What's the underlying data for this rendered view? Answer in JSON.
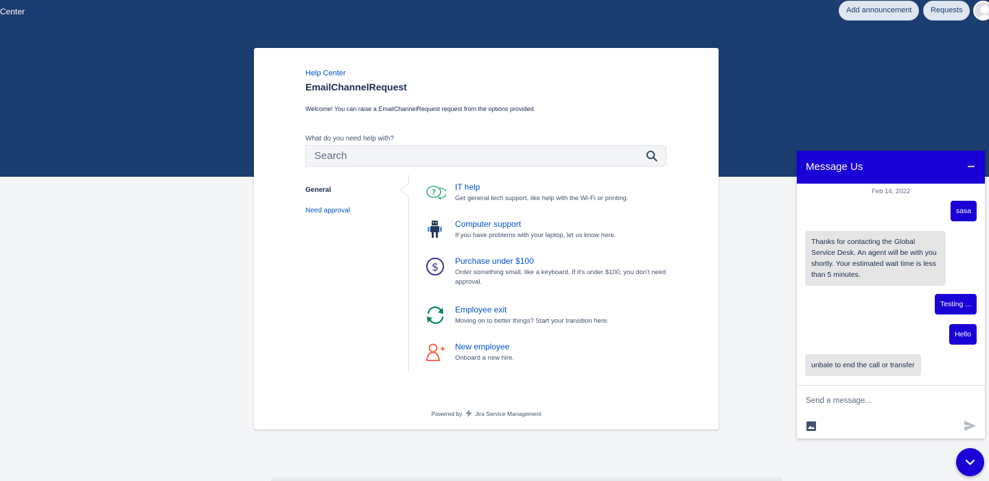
{
  "header": {
    "site_title": "Center",
    "add_announcement_label": "Add announcement",
    "requests_label": "Requests"
  },
  "portal": {
    "breadcrumb": "Help Center",
    "title": "EmailChannelRequest",
    "welcome": "Welcome! You can raise a EmailChannelRequest request from the options provided.",
    "help_label": "What do you need help with?",
    "search_placeholder": "Search",
    "groups": [
      {
        "label": "General",
        "selected": true
      },
      {
        "label": "Need approval",
        "selected": false
      }
    ],
    "request_types": [
      {
        "title": "IT help",
        "description": "Get general tech support, like help with the Wi-Fi or printing.",
        "icon": "question-bubble-icon"
      },
      {
        "title": "Computer support",
        "description": "If you have problems with your laptop, let us know here.",
        "icon": "robot-icon"
      },
      {
        "title": "Purchase under $100",
        "description": "Order something small, like a keyboard. If it's under $100, you don't need approval.",
        "icon": "dollar-icon"
      },
      {
        "title": "Employee exit",
        "description": "Moving on to better things? Start your transition here.",
        "icon": "cycle-arrows-icon"
      },
      {
        "title": "New employee",
        "description": "Onboard a new hire.",
        "icon": "add-person-icon"
      }
    ],
    "powered_prefix": "Powered by",
    "powered_product": "Jira Service Management"
  },
  "chat": {
    "title": "Message Us",
    "date": "Feb 14, 2022",
    "messages": [
      {
        "from": "user",
        "text": "sasa"
      },
      {
        "from": "agent",
        "text": "Thanks for contacting the Global Service Desk. An agent will be with you shortly. Your estimated wait time is less than 5 minutes."
      },
      {
        "from": "user",
        "text": "Testing ..."
      },
      {
        "from": "user",
        "text": "Hello"
      },
      {
        "from": "agent",
        "text": "unbale to end the call or transfer"
      }
    ],
    "input_placeholder": "Send a message..."
  },
  "colors": {
    "banner": "#1b3d6f",
    "chat_accent": "#1a00d6",
    "link": "#0052cc"
  }
}
